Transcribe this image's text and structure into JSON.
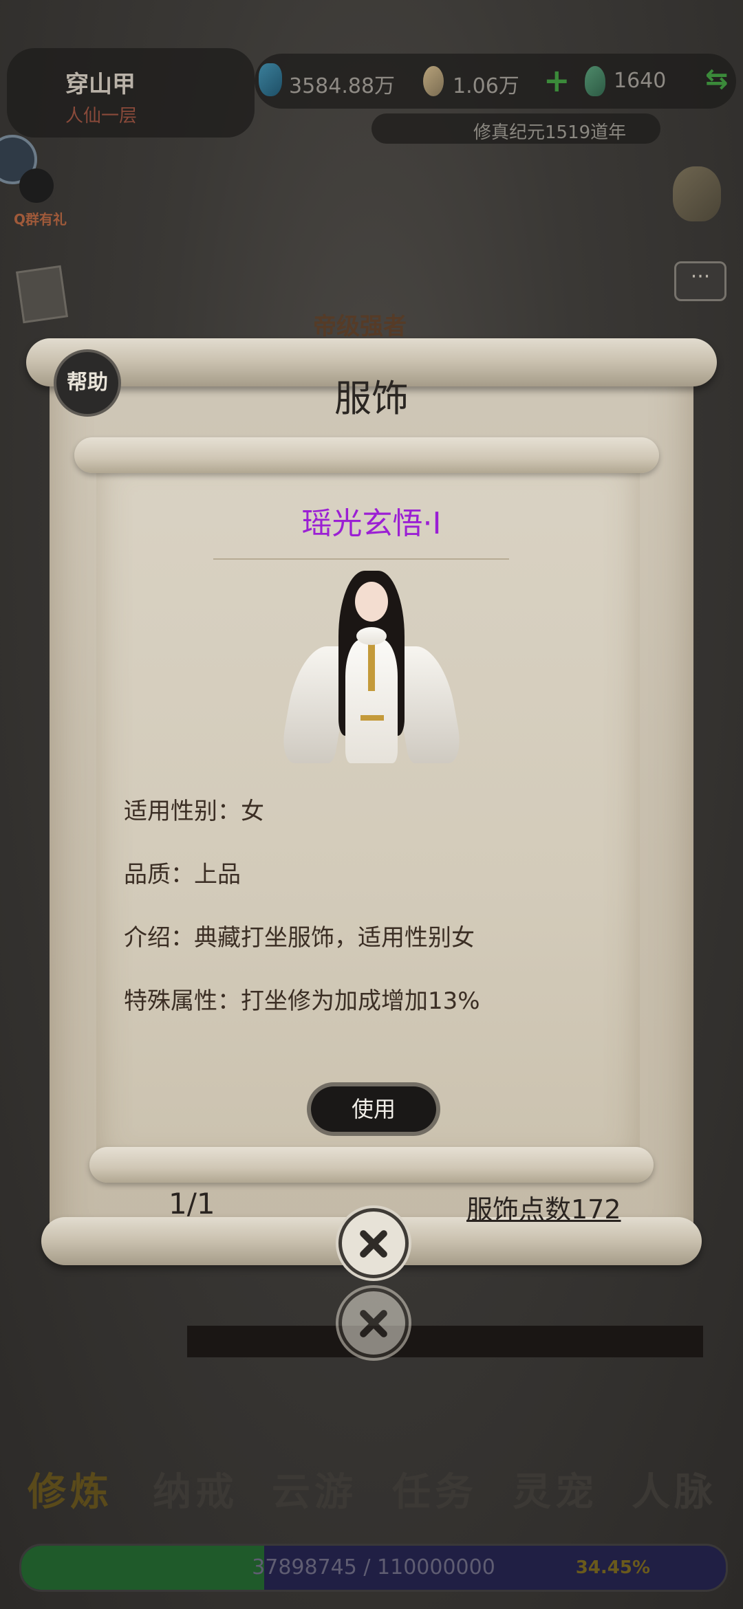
{
  "player": {
    "name": "穿山甲",
    "realm": "人仙一层"
  },
  "resources": {
    "spirit_stones": "3584.88万",
    "gold": "1.06万",
    "jade": "1640"
  },
  "calendar": "修真纪元1519道年",
  "side": {
    "qq_label": "Q群有礼",
    "chat_symbol": "···"
  },
  "background_title": "帝级强者",
  "modal": {
    "help_label": "帮助",
    "title": "服饰",
    "item": {
      "name": "瑶光玄悟·I",
      "attributes": [
        "适用性别：女",
        "品质：上品",
        "介绍：典藏打坐服饰，适用性别女",
        "特殊属性：打坐修为加成增加13%"
      ]
    },
    "use_label": "使用",
    "pager": "1/1",
    "points_label": "服饰点数172"
  },
  "bottom_nav": [
    "修炼",
    "纳戒",
    "云游",
    "任务",
    "灵宠",
    "人脉"
  ],
  "exp": {
    "text": "37898745 / 110000000",
    "percent_label": "34.45%",
    "fraction": 0.3445
  },
  "colors": {
    "item_name": "#9b1fd4",
    "exp_fill": "#1f5a2a",
    "accent_green": "#3b8a3a"
  }
}
